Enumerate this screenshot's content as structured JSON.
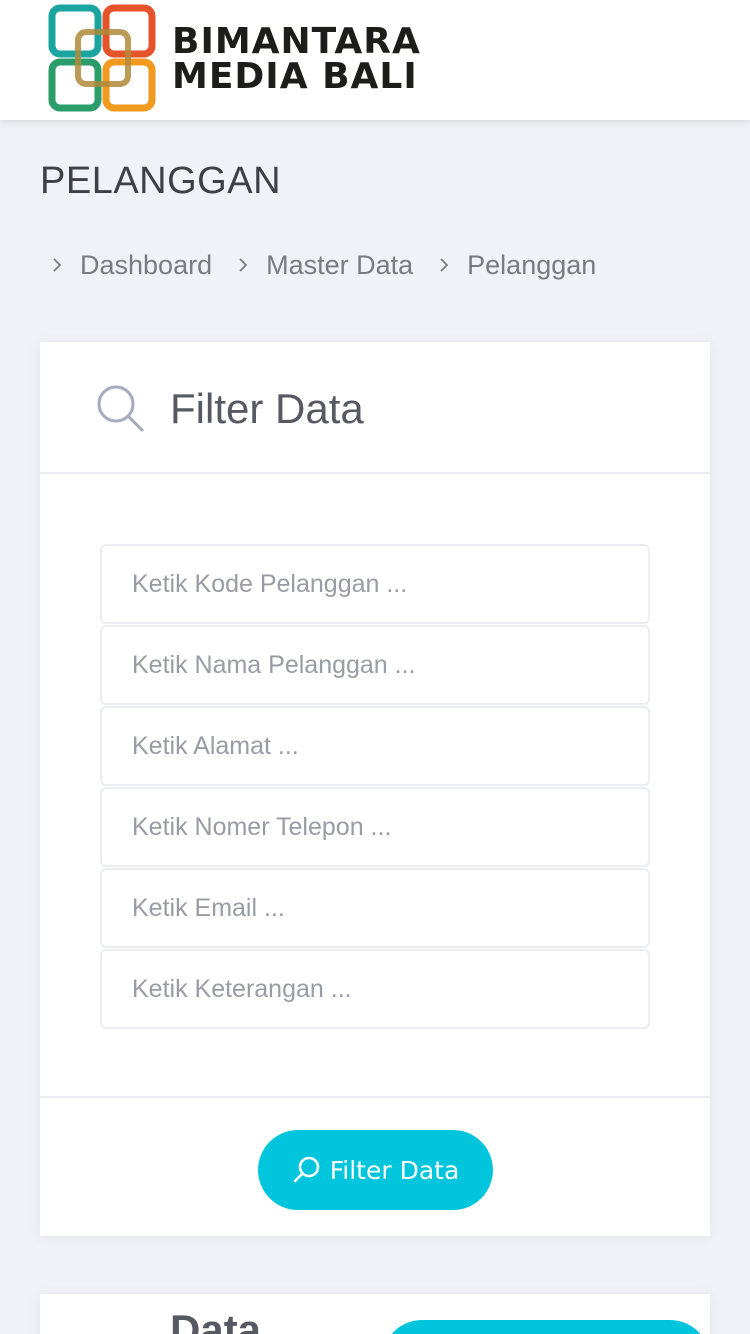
{
  "brand": {
    "line1": "BIMANTARA",
    "line2": "MEDIA BALI",
    "colors": [
      "#e5532a",
      "#f29a1f",
      "#1aa5a0",
      "#2a9d6a"
    ]
  },
  "page": {
    "title": "PELANGGAN"
  },
  "breadcrumb": [
    {
      "label": "Dashboard"
    },
    {
      "label": "Master Data"
    },
    {
      "label": "Pelanggan"
    }
  ],
  "filter_card": {
    "title": "Filter Data",
    "icon": "search-icon",
    "fields": [
      {
        "placeholder": "Ketik Kode Pelanggan ...",
        "value": ""
      },
      {
        "placeholder": "Ketik Nama Pelanggan ...",
        "value": ""
      },
      {
        "placeholder": "Ketik Alamat ...",
        "value": ""
      },
      {
        "placeholder": "Ketik Nomer Telepon ...",
        "value": ""
      },
      {
        "placeholder": "Ketik Email ...",
        "value": ""
      },
      {
        "placeholder": "Ketik Keterangan ...",
        "value": ""
      }
    ],
    "button_label": "Filter Data"
  },
  "data_card": {
    "title": "Data"
  },
  "colors": {
    "accent": "#00c5dc",
    "background": "#f1f2f7",
    "text": "#3f4047"
  }
}
